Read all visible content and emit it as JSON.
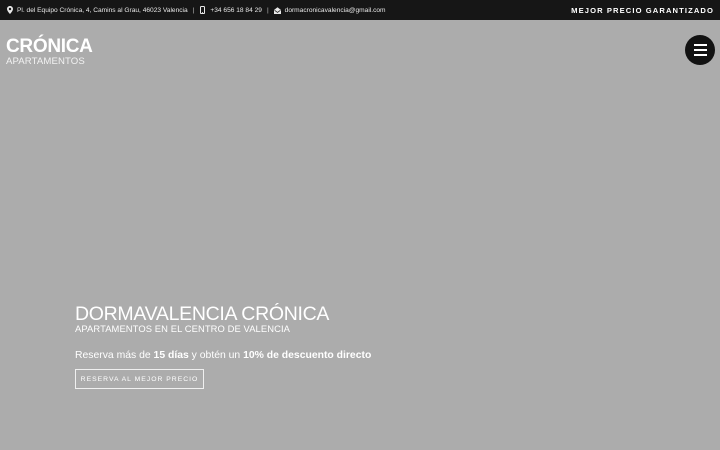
{
  "topbar": {
    "address": "Pl. del Equipo Crónica, 4, Camins al Grau, 46023 Valencia",
    "phone": "+34 656 18 84 29",
    "email": "dormacronicavalencia@gmail.com",
    "separator": "|",
    "promo": "MEJOR PRECIO GARANTIZADO"
  },
  "logo": {
    "main": "CRÓNICA",
    "sub": "APARTAMENTOS"
  },
  "hero": {
    "title": "DORMAVALENCIA CRÓNICA",
    "subtitle": "APARTAMENTOS EN EL CENTRO DE VALENCIA",
    "offer": {
      "prefix": "Reserva más de ",
      "days": "15 días",
      "middle": " y obtén un ",
      "discount": "10% de descuento directo"
    },
    "cta": "RESERVA AL MEJOR PRECIO"
  },
  "icons": {
    "address": "map-pin-icon",
    "phone": "mobile-phone-icon",
    "email": "envelope-icon",
    "menu": "hamburger-menu-icon"
  },
  "colors": {
    "topbar_bg": "#161616",
    "hero_bg": "#acacac",
    "menu_button_bg": "#121212",
    "text": "#ffffff"
  }
}
